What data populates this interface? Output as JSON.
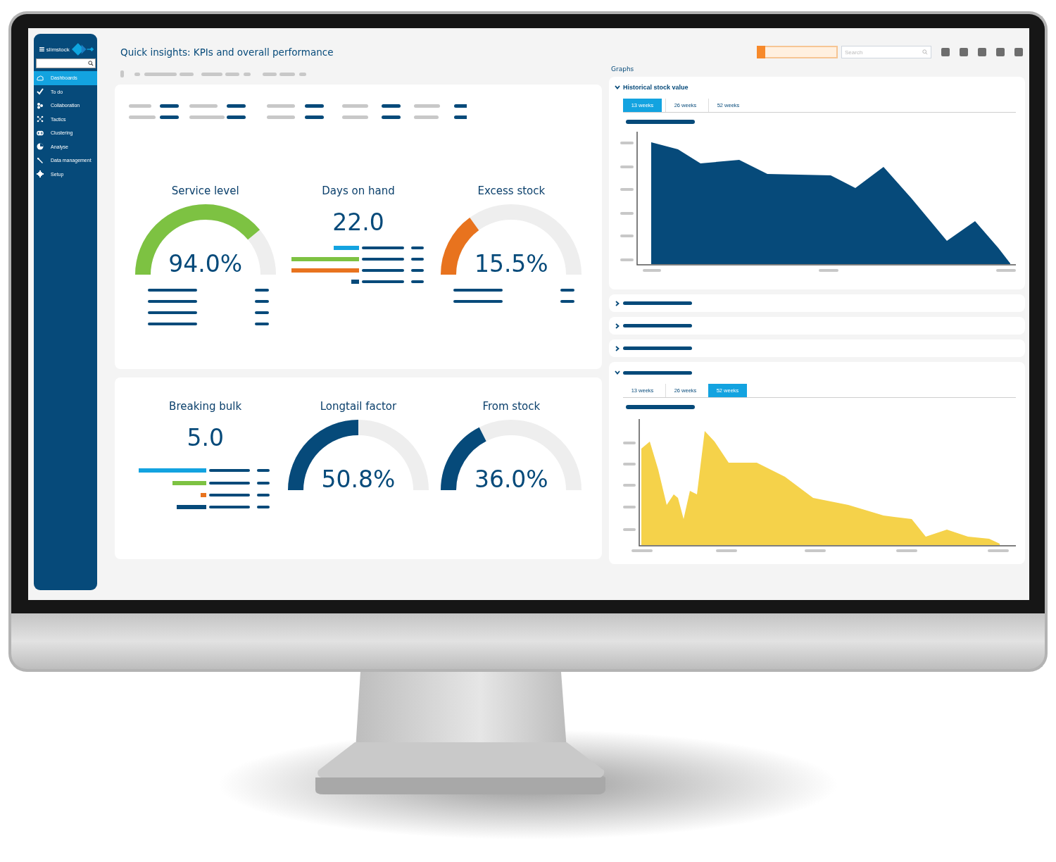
{
  "sidebar": {
    "brand": "slimstock",
    "items": [
      {
        "label": "Dashboards",
        "selected": true
      },
      {
        "label": "To do",
        "selected": false
      },
      {
        "label": "Collaboration",
        "selected": false
      },
      {
        "label": "Tactics",
        "selected": false
      },
      {
        "label": "Clustering",
        "selected": false
      },
      {
        "label": "Analyse",
        "selected": false
      },
      {
        "label": "Data management",
        "selected": false
      },
      {
        "label": "Setup",
        "selected": false
      }
    ]
  },
  "header": {
    "title": "Quick insights: KPIs and overall performance",
    "search": {
      "placeholder": "Search"
    }
  },
  "kpi_panels": [
    {
      "kpis": [
        {
          "kind": "gauge",
          "title": "Service level",
          "value": "94.0%",
          "color": "#7dc242"
        },
        {
          "kind": "number",
          "title": "Days on hand",
          "value": "22.0"
        },
        {
          "kind": "gauge",
          "title": "Excess stock",
          "value": "15.5%",
          "color": "#e8731e"
        }
      ]
    },
    {
      "kpis": [
        {
          "kind": "number",
          "title": "Breaking bulk",
          "value": "5.0"
        },
        {
          "kind": "gauge",
          "title": "Longtail factor",
          "value": "50.8%",
          "color": "#064a7a"
        },
        {
          "kind": "gauge",
          "title": "From stock",
          "value": "36.0%",
          "color": "#064a7a"
        }
      ]
    }
  ],
  "graphs": {
    "label": "Graphs",
    "sections": [
      {
        "title": "Historical stock value",
        "expanded": true,
        "color": "#064a7a",
        "tabs": [
          {
            "label": "13 weeks",
            "selected": true
          },
          {
            "label": "26 weeks",
            "selected": false
          },
          {
            "label": "52 weeks",
            "selected": false
          }
        ]
      },
      {
        "expanded": false
      },
      {
        "expanded": false
      },
      {
        "expanded": false
      },
      {
        "expanded": true,
        "color": "#f5d24a",
        "tabs": [
          {
            "label": "13 weeks",
            "selected": false
          },
          {
            "label": "26 weeks",
            "selected": false
          },
          {
            "label": "52 weeks",
            "selected": true
          }
        ]
      }
    ]
  }
}
